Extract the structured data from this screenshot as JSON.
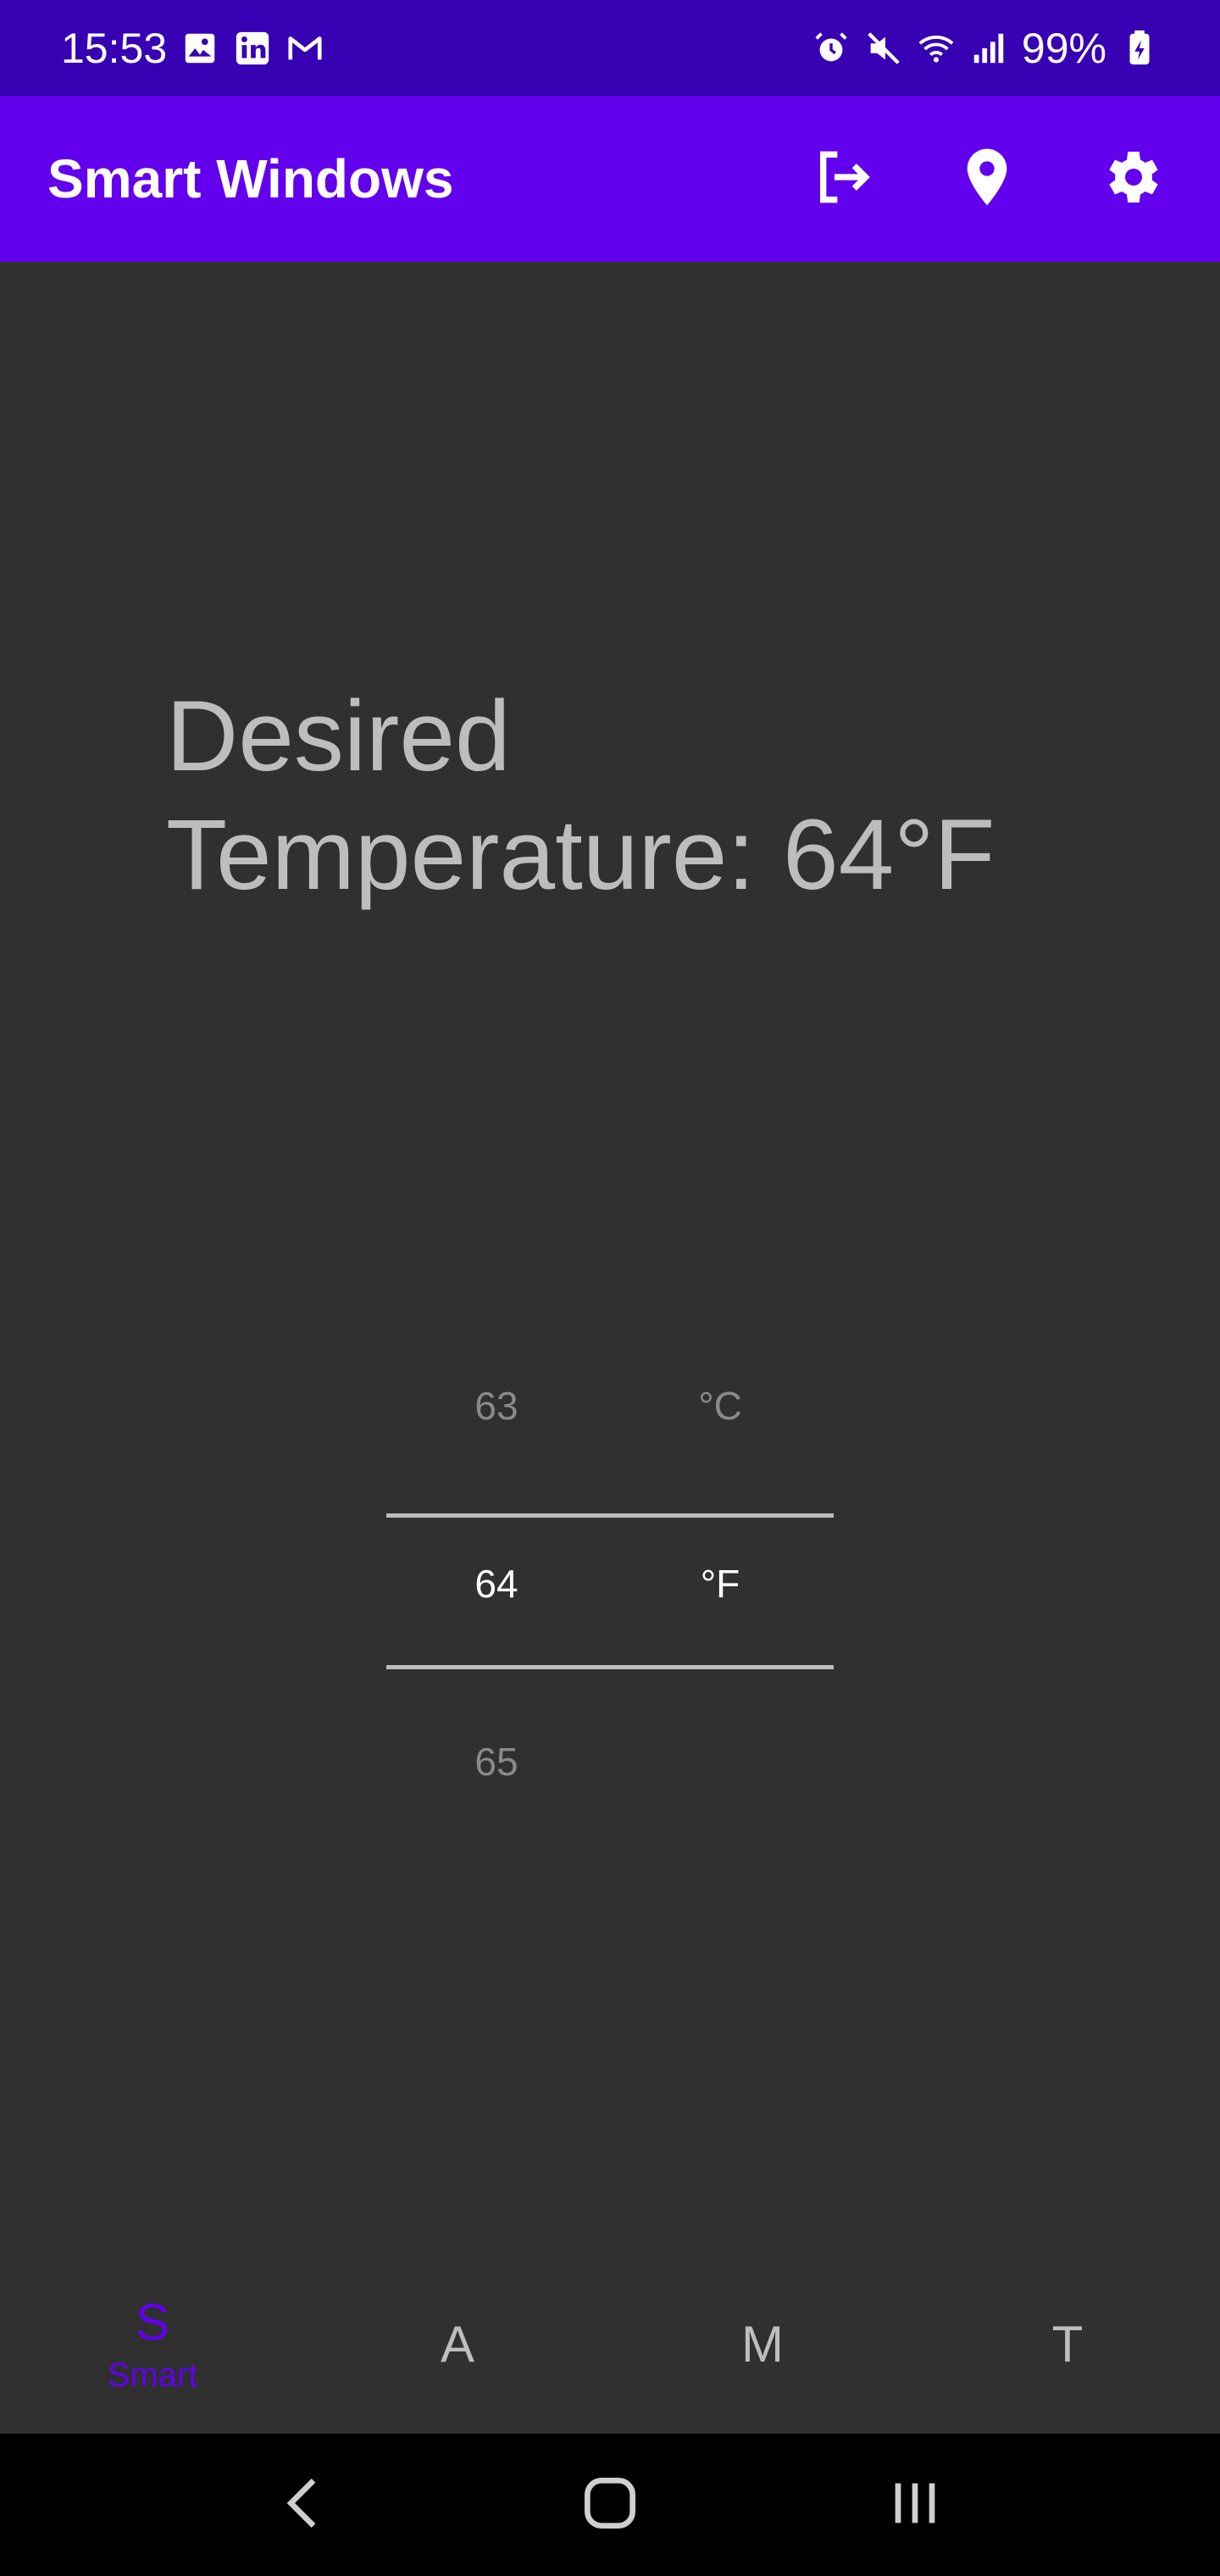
{
  "status_bar": {
    "time": "15:53",
    "battery": "99%",
    "notification_icons": [
      "image-icon",
      "linkedin-icon",
      "gmail-icon"
    ],
    "system_icons": [
      "alarm-icon",
      "mute-icon",
      "wifi-icon",
      "signal-icon",
      "battery-charging-icon"
    ]
  },
  "app_bar": {
    "title": "Smart Windows",
    "actions": [
      "logout-icon",
      "location-icon",
      "settings-icon"
    ]
  },
  "main": {
    "desired_label": "Desired",
    "temperature_line": "Temperature: 64°F"
  },
  "picker": {
    "numbers": {
      "prev": "63",
      "current": "64",
      "next": "65"
    },
    "units": {
      "prev": "°C",
      "current": "°F"
    }
  },
  "bottom_nav": {
    "items": [
      {
        "letter": "S",
        "label": "Smart",
        "active": true
      },
      {
        "letter": "A",
        "label": "",
        "active": false
      },
      {
        "letter": "M",
        "label": "",
        "active": false
      },
      {
        "letter": "T",
        "label": "",
        "active": false
      }
    ]
  },
  "colors": {
    "status_bar": "#3700b3",
    "app_bar": "#6200ee",
    "background": "#303030",
    "accent": "#6200ee"
  }
}
